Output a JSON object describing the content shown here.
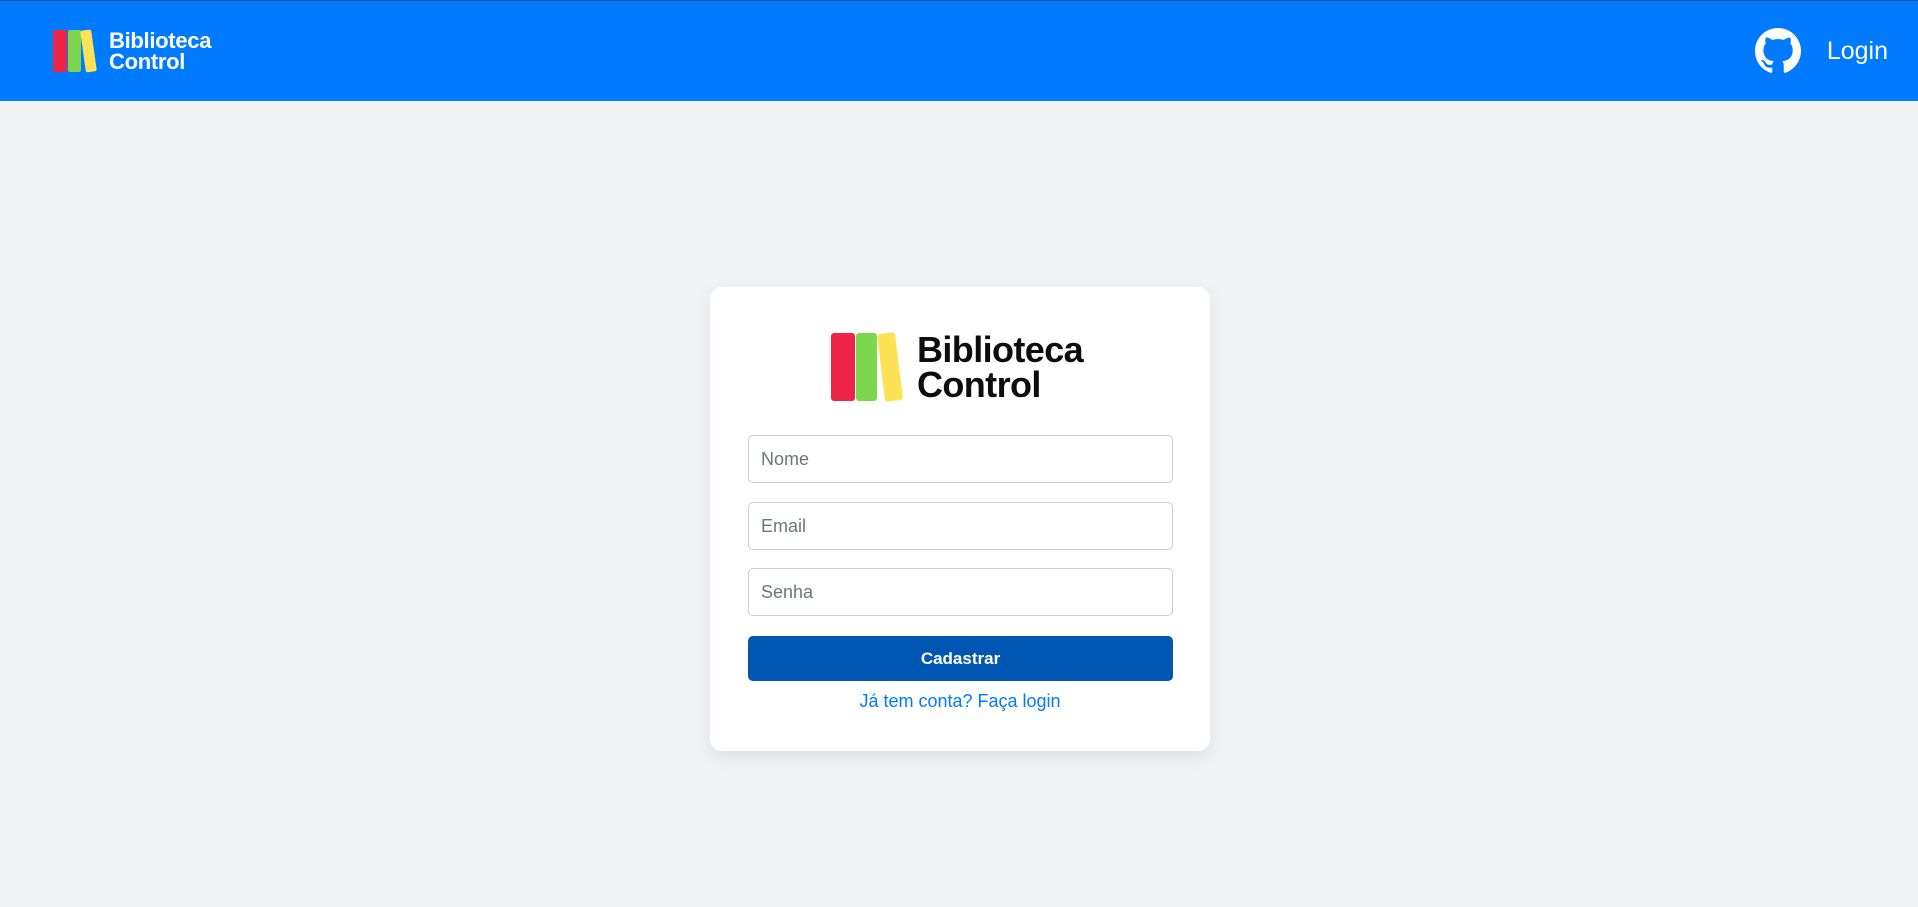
{
  "header": {
    "brand_line1": "Biblioteca",
    "brand_line2": "Control",
    "github_icon": "github-icon",
    "login_label": "Login"
  },
  "card": {
    "logo_line1": "Biblioteca",
    "logo_line2": "Control",
    "fields": {
      "nome_placeholder": "Nome",
      "email_placeholder": "Email",
      "senha_placeholder": "Senha"
    },
    "submit_label": "Cadastrar",
    "login_link": "Já tem conta? Faça login"
  },
  "colors": {
    "primary": "#007bff",
    "button": "#0056b3",
    "background": "#f0f2f5",
    "book_red": "#ee2449",
    "book_green": "#7dd64f",
    "book_yellow": "#fde255"
  }
}
